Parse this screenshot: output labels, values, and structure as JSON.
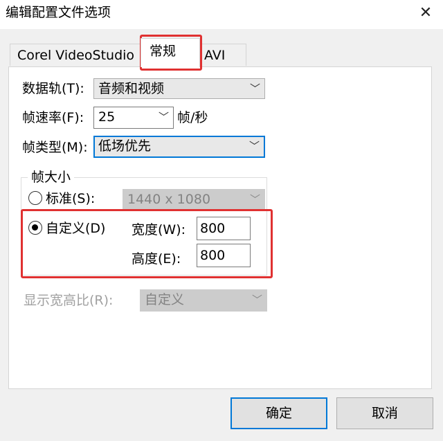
{
  "window": {
    "title": "编辑配置文件选项",
    "close_glyph": "✕"
  },
  "tabs": [
    {
      "label": "Corel VideoStudio"
    },
    {
      "label": "常规"
    },
    {
      "label": "AVI"
    }
  ],
  "form": {
    "data_track": {
      "label": "数据轨(T):",
      "value": "音频和视频"
    },
    "frame_rate": {
      "label": "帧速率(F):",
      "value": "25",
      "unit": "帧/秒"
    },
    "frame_type": {
      "label": "帧类型(M):",
      "value": "低场优先"
    },
    "frame_size": {
      "group_label": "帧大小",
      "standard": {
        "label": "标准(S):",
        "value": "1440 x 1080",
        "selected": false
      },
      "custom": {
        "label": "自定义(D)",
        "selected": true
      },
      "width": {
        "label": "宽度(W):",
        "value": "800"
      },
      "height": {
        "label": "高度(E):",
        "value": "800"
      }
    },
    "aspect_ratio": {
      "label": "显示宽高比(R):",
      "value": "自定义"
    }
  },
  "buttons": {
    "ok": "确定",
    "cancel": "取消"
  },
  "icons": {
    "dropdown": "chevron-down-icon",
    "close": "close-icon"
  },
  "colors": {
    "highlight": "#e03131",
    "focus": "#0078d7"
  }
}
